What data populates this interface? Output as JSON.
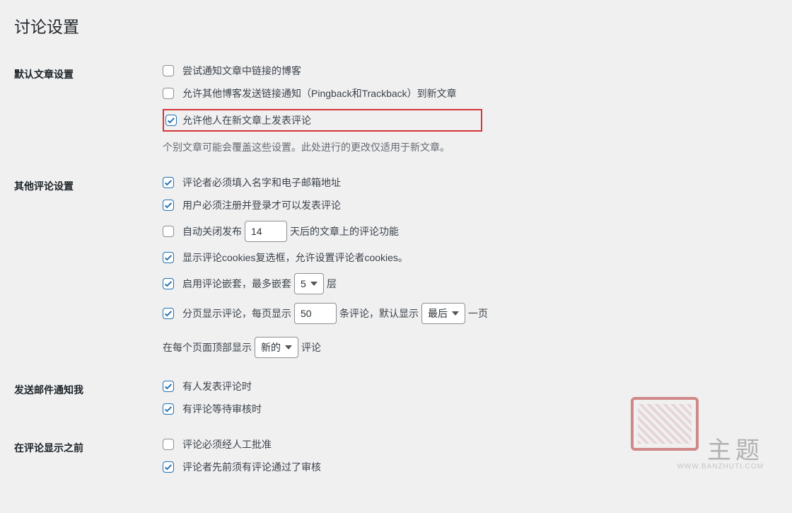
{
  "page_title": "讨论设置",
  "sections": {
    "default_post": {
      "heading": "默认文章设置",
      "opt_pingback": "尝试通知文章中链接的博客",
      "opt_trackback": "允许其他博客发送链接通知（Pingback和Trackback）到新文章",
      "opt_allow_comments": "允许他人在新文章上发表评论",
      "note": "个别文章可能会覆盖这些设置。此处进行的更改仅适用于新文章。"
    },
    "other_comment": {
      "heading": "其他评论设置",
      "opt_require_name_email": "评论者必须填入名字和电子邮箱地址",
      "opt_require_login": "用户必须注册并登录才可以发表评论",
      "opt_auto_close_pre": "自动关闭发布",
      "auto_close_days": "14",
      "opt_auto_close_post": "天后的文章上的评论功能",
      "opt_cookies": "显示评论cookies复选框，允许设置评论者cookies。",
      "opt_thread_pre": "启用评论嵌套，最多嵌套",
      "thread_depth": "5",
      "opt_thread_post": "层",
      "opt_paginate_pre": "分页显示评论，每页显示",
      "per_page": "50",
      "opt_paginate_mid": "条评论，默认显示",
      "default_page": "最后",
      "opt_paginate_post": "一页",
      "opt_order_pre": "在每个页面顶部显示",
      "order": "新的",
      "opt_order_post": "评论"
    },
    "email_notify": {
      "heading": "发送邮件通知我",
      "opt_on_comment": "有人发表评论时",
      "opt_on_moderation": "有评论等待审核时"
    },
    "before_show": {
      "heading": "在评论显示之前",
      "opt_manual_approve": "评论必须经人工批准",
      "opt_prev_approved": "评论者先前须有评论通过了审核"
    }
  },
  "watermark": {
    "text": "主题",
    "url": "WWW.BANZHUTI.COM"
  }
}
